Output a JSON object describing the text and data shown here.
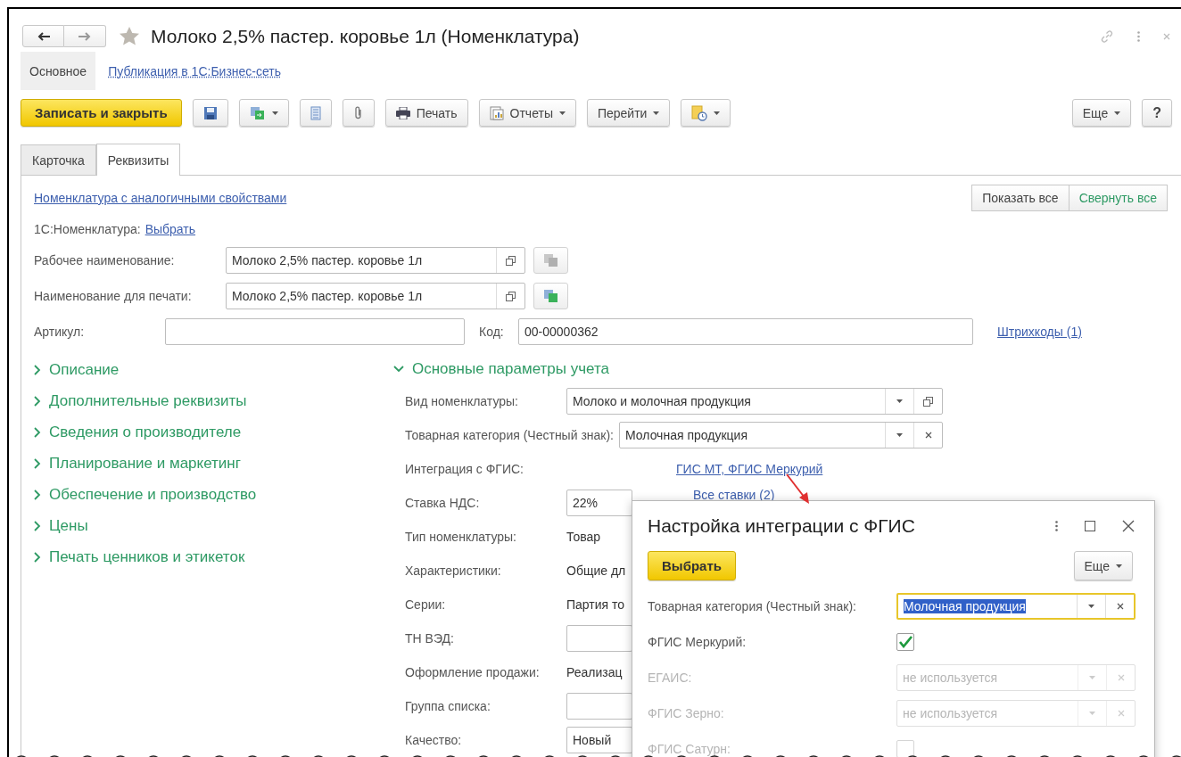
{
  "window": {
    "title": "Молоко 2,5% пастер. коровье 1л (Номенклатура)",
    "favorite": false
  },
  "sections": [
    {
      "label": "Основное",
      "selected": true
    },
    {
      "label": "Публикация в 1С:Бизнес-сеть",
      "selected": false
    }
  ],
  "toolbar": {
    "buttons": [
      {
        "kind": "primary",
        "label": "Записать и закрыть",
        "menu": false
      },
      {
        "kind": "save",
        "menu": false
      },
      {
        "kind": "clone",
        "menu": true
      },
      {
        "kind": "list",
        "menu": false
      },
      {
        "kind": "attach",
        "menu": false
      },
      {
        "kind": "print",
        "label": "Печать",
        "menu": false
      },
      {
        "kind": "reports",
        "label": "Отчеты",
        "menu": true
      },
      {
        "kind": "plain",
        "label": "Перейти",
        "menu": true
      },
      {
        "kind": "schedule",
        "menu": true
      }
    ],
    "right_buttons": [
      {
        "kind": "plain",
        "label": "Еще",
        "menu": true
      },
      {
        "kind": "help",
        "label": "?",
        "menu": false
      }
    ]
  },
  "tabs": [
    {
      "label": "Карточка",
      "selected": false
    },
    {
      "label": "Реквизиты",
      "selected": true
    }
  ],
  "form": {
    "analog_link": "Номенклатура с аналогичными свойствами",
    "show_all": "Показать все",
    "collapse_all": "Свернуть все",
    "catalog_label": "1С:Номенклатура:",
    "catalog_link": "Выбрать",
    "work_name": {
      "label": "Рабочее наименование:",
      "value": "Молоко 2,5% пастер. коровье 1л",
      "action_enabled": false
    },
    "print_name": {
      "label": "Наименование для печати:",
      "value": "Молоко 2,5% пастер. коровье 1л",
      "action_enabled": true
    },
    "article": {
      "label": "Артикул:"
    },
    "code": {
      "label": "Код:",
      "value": "00-00000362"
    },
    "barcodes_link": "Штрихкоды (1)"
  },
  "groups": [
    {
      "label": "Описание",
      "expanded": false
    },
    {
      "label": "Дополнительные реквизиты",
      "expanded": false
    },
    {
      "label": "Сведения о производителе",
      "expanded": false
    },
    {
      "label": "Планирование и маркетинг",
      "expanded": false
    },
    {
      "label": "Обеспечение и производство",
      "expanded": false
    },
    {
      "label": "Цены",
      "expanded": false
    },
    {
      "label": "Печать ценников и этикеток",
      "expanded": false
    }
  ],
  "main_group": {
    "label": "Основные параметры учета",
    "expanded": true,
    "rows": [
      {
        "kind": "lookup",
        "label": "Вид номенклатуры:",
        "value": "Молоко и молочная продукция"
      },
      {
        "kind": "choice",
        "label": "Товарная категория (Честный знак):",
        "value": "Молочная продукция"
      },
      {
        "kind": "link",
        "label": "Интеграция с ФГИС:",
        "value": "ГИС МТ, ФГИС Меркурий"
      },
      {
        "kind": "input",
        "label": "Ставка НДС:",
        "value": "22%",
        "link": "Все ставки (2)"
      },
      {
        "kind": "text",
        "label": "Тип номенклатуры:",
        "value": "Товар"
      },
      {
        "kind": "text",
        "label": "Характеристики:",
        "value": "Общие дл"
      },
      {
        "kind": "text",
        "label": "Серии:",
        "value": "Партия то"
      },
      {
        "kind": "input",
        "label": "ТН ВЭД:"
      },
      {
        "kind": "text",
        "label": "Оформление продажи:",
        "value": "Реализац"
      },
      {
        "kind": "input",
        "label": "Группа списка:"
      },
      {
        "kind": "input",
        "label": "Качество:",
        "value": "Новый"
      }
    ]
  },
  "dialog": {
    "title": "Настройка интеграции с ФГИС",
    "select_button": "Выбрать",
    "more_button": "Еще",
    "rows": [
      {
        "kind": "combo",
        "label": "Товарная категория (Честный знак):",
        "value": "Молочная продукция",
        "focused": true,
        "disabled": false
      },
      {
        "kind": "checkbox",
        "label": "ФГИС Меркурий:",
        "checked": true,
        "disabled": false
      },
      {
        "kind": "combo",
        "label": "ЕГАИС:",
        "value": "не используется",
        "focused": false,
        "disabled": true
      },
      {
        "kind": "combo",
        "label": "ФГИС Зерно:",
        "value": "не используется",
        "focused": false,
        "disabled": true
      },
      {
        "kind": "checkbox",
        "label": "ФГИС Сатурн:",
        "checked": false,
        "disabled": true
      }
    ]
  }
}
